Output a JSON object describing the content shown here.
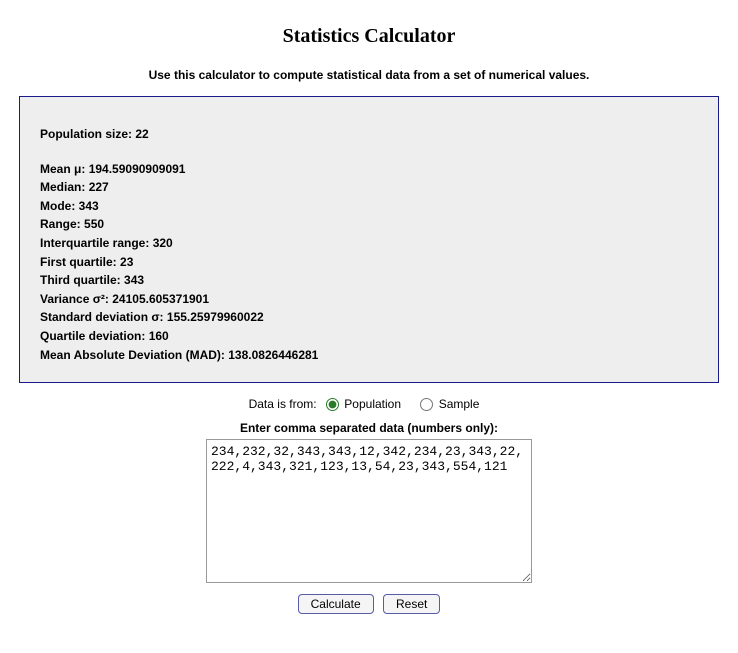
{
  "title": "Statistics Calculator",
  "subtitle": "Use this calculator to compute statistical data from a set of numerical values.",
  "results": {
    "population_size": {
      "label": "Population size:",
      "value": "22"
    },
    "mean": {
      "label": "Mean μ:",
      "value": "194.59090909091"
    },
    "median": {
      "label": "Median:",
      "value": "227"
    },
    "mode": {
      "label": "Mode:",
      "value": "343"
    },
    "range": {
      "label": "Range:",
      "value": "550"
    },
    "iqr": {
      "label": "Interquartile range:",
      "value": "320"
    },
    "q1": {
      "label": "First quartile:",
      "value": "23"
    },
    "q3": {
      "label": "Third quartile:",
      "value": "343"
    },
    "variance": {
      "label": "Variance σ²:",
      "value": "24105.605371901"
    },
    "stddev": {
      "label": "Standard deviation σ:",
      "value": "155.25979960022"
    },
    "qdev": {
      "label": "Quartile deviation:",
      "value": "160"
    },
    "mad": {
      "label": "Mean Absolute Deviation (MAD):",
      "value": "138.0826446281"
    }
  },
  "data_source": {
    "prefix": "Data is from:",
    "population_label": "Population",
    "sample_label": "Sample",
    "selected": "population"
  },
  "input": {
    "label": "Enter comma separated data (numbers only):",
    "value": "234,232,32,343,343,12,342,234,23,343,22,222,4,343,321,123,13,54,23,343,554,121"
  },
  "buttons": {
    "calculate": "Calculate",
    "reset": "Reset"
  }
}
